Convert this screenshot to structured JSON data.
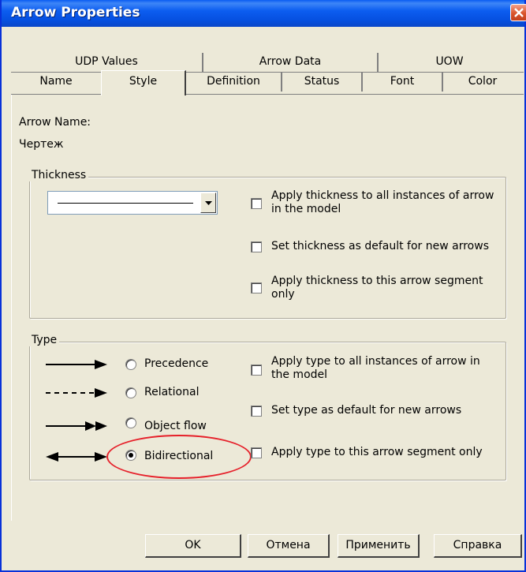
{
  "window": {
    "title": "Arrow Properties"
  },
  "tabs": {
    "row1": [
      "UDP Values",
      "Arrow Data",
      "UOW"
    ],
    "row2": [
      "Name",
      "Style",
      "Definition",
      "Status",
      "Font",
      "Color"
    ],
    "active": "Style"
  },
  "arrow_name": {
    "label": "Arrow Name:",
    "value": "Чертеж"
  },
  "thickness": {
    "group_label": "Thickness",
    "options": [
      "Apply thickness to all instances of arrow in the model",
      "Set thickness as default for new arrows",
      "Apply thickness to this arrow segment only"
    ]
  },
  "type": {
    "group_label": "Type",
    "radios": [
      {
        "label": "Precedence",
        "arrow_icon": "solid-arrow-icon",
        "selected": false
      },
      {
        "label": "Relational",
        "arrow_icon": "dashed-arrow-icon",
        "selected": false
      },
      {
        "label": "Object flow",
        "arrow_icon": "double-head-arrow-icon",
        "selected": false
      },
      {
        "label": "Bidirectional",
        "arrow_icon": "bidirectional-arrow-icon",
        "selected": true
      }
    ],
    "options": [
      "Apply type to all instances of arrow in the model",
      "Set type as default for new arrows",
      "Apply type to this arrow segment only"
    ]
  },
  "buttons": {
    "ok": "OK",
    "cancel": "Отмена",
    "apply": "Применить",
    "help": "Справка"
  },
  "colors": {
    "titlebar": "#0a5cf2",
    "dialog_bg": "#ece9d8",
    "highlight_ellipse": "#e6202a"
  }
}
